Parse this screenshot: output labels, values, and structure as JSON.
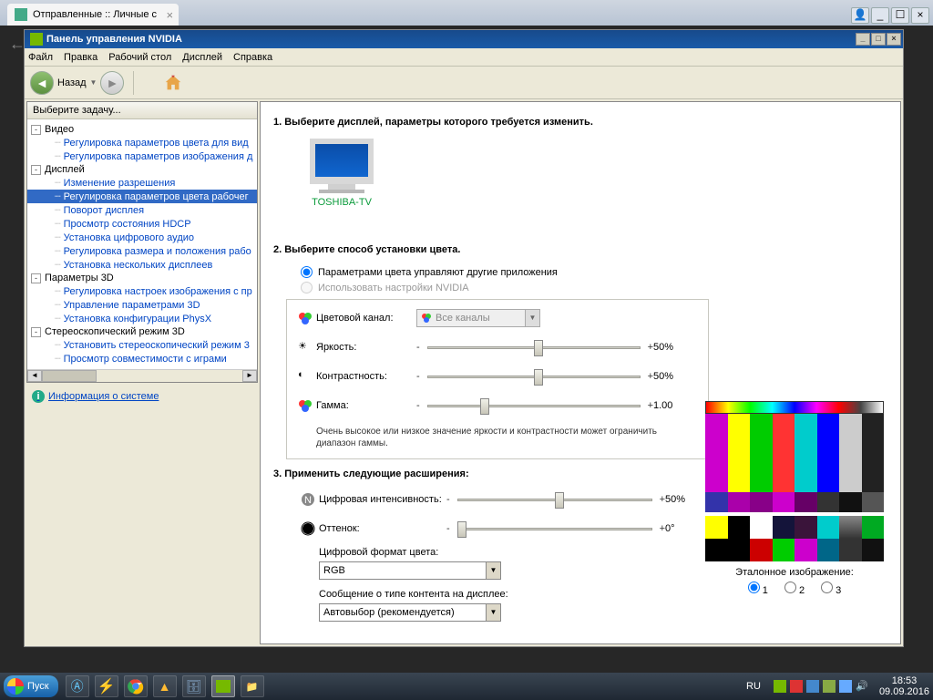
{
  "chrome": {
    "tab_title": "Отправленные :: Личные с"
  },
  "window": {
    "title": "Панель управления NVIDIA",
    "menu": [
      "Файл",
      "Правка",
      "Рабочий стол",
      "Дисплей",
      "Справка"
    ],
    "nav_back_label": "Назад"
  },
  "sidebar": {
    "header": "Выберите задачу...",
    "groups": [
      {
        "label": "Видео",
        "items": [
          "Регулировка параметров цвета для вид",
          "Регулировка параметров изображения д"
        ]
      },
      {
        "label": "Дисплей",
        "items": [
          "Изменение разрешения",
          "Регулировка параметров цвета рабочег",
          "Поворот дисплея",
          "Просмотр состояния HDCP",
          "Установка цифрового аудио",
          "Регулировка размера и положения рабо",
          "Установка нескольких дисплеев"
        ]
      },
      {
        "label": "Параметры 3D",
        "items": [
          "Регулировка настроек изображения с пр",
          "Управление параметрами 3D",
          "Установка конфигурации PhysX"
        ]
      },
      {
        "label": "Стереоскопический режим 3D",
        "items": [
          "Установить стереоскопический режим 3",
          "Просмотр совместимости с играми"
        ]
      }
    ],
    "selected": "Регулировка параметров цвета рабочег",
    "info_link": "Информация о системе"
  },
  "main": {
    "section1": "1. Выберите дисплей, параметры которого требуется изменить.",
    "display_name": "TOSHIBA-TV",
    "section2": "2. Выберите способ установки цвета.",
    "radio_other": "Параметрами цвета управляют другие приложения",
    "radio_nvidia": "Использовать настройки NVIDIA",
    "channel_label": "Цветовой канал:",
    "channel_value": "Все каналы",
    "brightness_label": "Яркость:",
    "brightness_value": "50%",
    "contrast_label": "Контрастность:",
    "contrast_value": "50%",
    "gamma_label": "Гамма:",
    "gamma_value": "1.00",
    "note": "Очень высокое или низкое значение яркости и контрастности может ограничить диапазон гаммы.",
    "section3": "3. Применить следующие расширения:",
    "vibrance_label": "Цифровая интенсивность:",
    "vibrance_value": "50%",
    "hue_label": "Оттенок:",
    "hue_value": "0°",
    "format_label": "Цифровой формат цвета:",
    "format_value": "RGB",
    "content_label": "Сообщение о типе контента на дисплее:",
    "content_value": "Автовыбор (рекомендуется)",
    "ref_label": "Эталонное изображение:",
    "ref_options": [
      "1",
      "2",
      "3"
    ]
  },
  "taskbar": {
    "start": "Пуск",
    "lang": "RU",
    "time": "18:53",
    "date": "09.09.2016"
  }
}
